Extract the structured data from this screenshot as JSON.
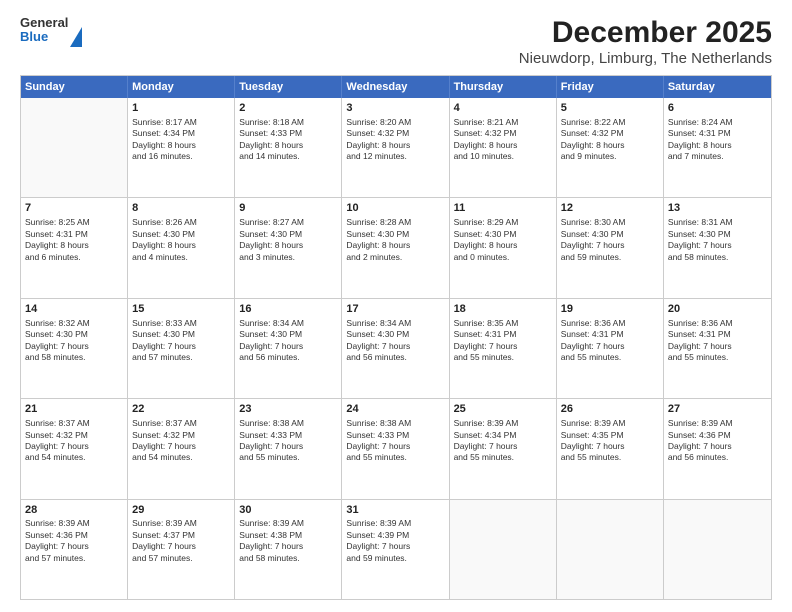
{
  "logo": {
    "general": "General",
    "blue": "Blue"
  },
  "title": "December 2025",
  "subtitle": "Nieuwdorp, Limburg, The Netherlands",
  "header_days": [
    "Sunday",
    "Monday",
    "Tuesday",
    "Wednesday",
    "Thursday",
    "Friday",
    "Saturday"
  ],
  "weeks": [
    [
      {
        "day": "",
        "lines": []
      },
      {
        "day": "1",
        "lines": [
          "Sunrise: 8:17 AM",
          "Sunset: 4:34 PM",
          "Daylight: 8 hours",
          "and 16 minutes."
        ]
      },
      {
        "day": "2",
        "lines": [
          "Sunrise: 8:18 AM",
          "Sunset: 4:33 PM",
          "Daylight: 8 hours",
          "and 14 minutes."
        ]
      },
      {
        "day": "3",
        "lines": [
          "Sunrise: 8:20 AM",
          "Sunset: 4:32 PM",
          "Daylight: 8 hours",
          "and 12 minutes."
        ]
      },
      {
        "day": "4",
        "lines": [
          "Sunrise: 8:21 AM",
          "Sunset: 4:32 PM",
          "Daylight: 8 hours",
          "and 10 minutes."
        ]
      },
      {
        "day": "5",
        "lines": [
          "Sunrise: 8:22 AM",
          "Sunset: 4:32 PM",
          "Daylight: 8 hours",
          "and 9 minutes."
        ]
      },
      {
        "day": "6",
        "lines": [
          "Sunrise: 8:24 AM",
          "Sunset: 4:31 PM",
          "Daylight: 8 hours",
          "and 7 minutes."
        ]
      }
    ],
    [
      {
        "day": "7",
        "lines": [
          "Sunrise: 8:25 AM",
          "Sunset: 4:31 PM",
          "Daylight: 8 hours",
          "and 6 minutes."
        ]
      },
      {
        "day": "8",
        "lines": [
          "Sunrise: 8:26 AM",
          "Sunset: 4:30 PM",
          "Daylight: 8 hours",
          "and 4 minutes."
        ]
      },
      {
        "day": "9",
        "lines": [
          "Sunrise: 8:27 AM",
          "Sunset: 4:30 PM",
          "Daylight: 8 hours",
          "and 3 minutes."
        ]
      },
      {
        "day": "10",
        "lines": [
          "Sunrise: 8:28 AM",
          "Sunset: 4:30 PM",
          "Daylight: 8 hours",
          "and 2 minutes."
        ]
      },
      {
        "day": "11",
        "lines": [
          "Sunrise: 8:29 AM",
          "Sunset: 4:30 PM",
          "Daylight: 8 hours",
          "and 0 minutes."
        ]
      },
      {
        "day": "12",
        "lines": [
          "Sunrise: 8:30 AM",
          "Sunset: 4:30 PM",
          "Daylight: 7 hours",
          "and 59 minutes."
        ]
      },
      {
        "day": "13",
        "lines": [
          "Sunrise: 8:31 AM",
          "Sunset: 4:30 PM",
          "Daylight: 7 hours",
          "and 58 minutes."
        ]
      }
    ],
    [
      {
        "day": "14",
        "lines": [
          "Sunrise: 8:32 AM",
          "Sunset: 4:30 PM",
          "Daylight: 7 hours",
          "and 58 minutes."
        ]
      },
      {
        "day": "15",
        "lines": [
          "Sunrise: 8:33 AM",
          "Sunset: 4:30 PM",
          "Daylight: 7 hours",
          "and 57 minutes."
        ]
      },
      {
        "day": "16",
        "lines": [
          "Sunrise: 8:34 AM",
          "Sunset: 4:30 PM",
          "Daylight: 7 hours",
          "and 56 minutes."
        ]
      },
      {
        "day": "17",
        "lines": [
          "Sunrise: 8:34 AM",
          "Sunset: 4:30 PM",
          "Daylight: 7 hours",
          "and 56 minutes."
        ]
      },
      {
        "day": "18",
        "lines": [
          "Sunrise: 8:35 AM",
          "Sunset: 4:31 PM",
          "Daylight: 7 hours",
          "and 55 minutes."
        ]
      },
      {
        "day": "19",
        "lines": [
          "Sunrise: 8:36 AM",
          "Sunset: 4:31 PM",
          "Daylight: 7 hours",
          "and 55 minutes."
        ]
      },
      {
        "day": "20",
        "lines": [
          "Sunrise: 8:36 AM",
          "Sunset: 4:31 PM",
          "Daylight: 7 hours",
          "and 55 minutes."
        ]
      }
    ],
    [
      {
        "day": "21",
        "lines": [
          "Sunrise: 8:37 AM",
          "Sunset: 4:32 PM",
          "Daylight: 7 hours",
          "and 54 minutes."
        ]
      },
      {
        "day": "22",
        "lines": [
          "Sunrise: 8:37 AM",
          "Sunset: 4:32 PM",
          "Daylight: 7 hours",
          "and 54 minutes."
        ]
      },
      {
        "day": "23",
        "lines": [
          "Sunrise: 8:38 AM",
          "Sunset: 4:33 PM",
          "Daylight: 7 hours",
          "and 55 minutes."
        ]
      },
      {
        "day": "24",
        "lines": [
          "Sunrise: 8:38 AM",
          "Sunset: 4:33 PM",
          "Daylight: 7 hours",
          "and 55 minutes."
        ]
      },
      {
        "day": "25",
        "lines": [
          "Sunrise: 8:39 AM",
          "Sunset: 4:34 PM",
          "Daylight: 7 hours",
          "and 55 minutes."
        ]
      },
      {
        "day": "26",
        "lines": [
          "Sunrise: 8:39 AM",
          "Sunset: 4:35 PM",
          "Daylight: 7 hours",
          "and 55 minutes."
        ]
      },
      {
        "day": "27",
        "lines": [
          "Sunrise: 8:39 AM",
          "Sunset: 4:36 PM",
          "Daylight: 7 hours",
          "and 56 minutes."
        ]
      }
    ],
    [
      {
        "day": "28",
        "lines": [
          "Sunrise: 8:39 AM",
          "Sunset: 4:36 PM",
          "Daylight: 7 hours",
          "and 57 minutes."
        ]
      },
      {
        "day": "29",
        "lines": [
          "Sunrise: 8:39 AM",
          "Sunset: 4:37 PM",
          "Daylight: 7 hours",
          "and 57 minutes."
        ]
      },
      {
        "day": "30",
        "lines": [
          "Sunrise: 8:39 AM",
          "Sunset: 4:38 PM",
          "Daylight: 7 hours",
          "and 58 minutes."
        ]
      },
      {
        "day": "31",
        "lines": [
          "Sunrise: 8:39 AM",
          "Sunset: 4:39 PM",
          "Daylight: 7 hours",
          "and 59 minutes."
        ]
      },
      {
        "day": "",
        "lines": []
      },
      {
        "day": "",
        "lines": []
      },
      {
        "day": "",
        "lines": []
      }
    ]
  ]
}
